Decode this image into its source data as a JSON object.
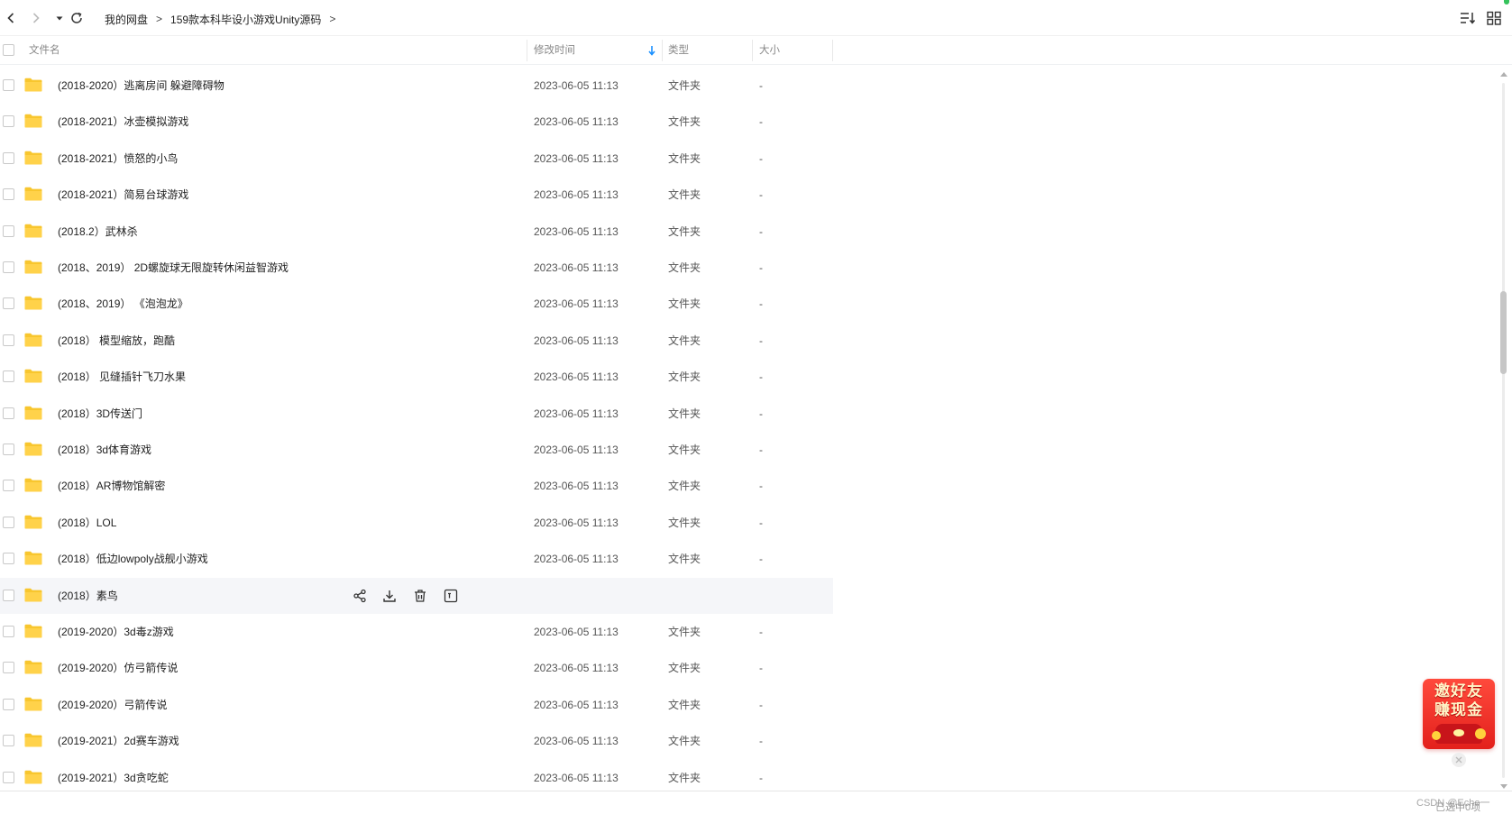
{
  "nav": {
    "breadcrumb": [
      {
        "label": "我的网盘"
      },
      {
        "label": "159款本科毕设小游戏Unity源码"
      }
    ],
    "separator": ">"
  },
  "columns": {
    "name": "文件名",
    "modified": "修改时间",
    "type": "类型",
    "size": "大小"
  },
  "files": [
    {
      "name": "(2018-2020）逃离房间 躲避障碍物",
      "modified": "2023-06-05 11:13",
      "type": "文件夹",
      "size": "-"
    },
    {
      "name": "(2018-2021）冰壶模拟游戏",
      "modified": "2023-06-05 11:13",
      "type": "文件夹",
      "size": "-"
    },
    {
      "name": "(2018-2021）愤怒的小鸟",
      "modified": "2023-06-05 11:13",
      "type": "文件夹",
      "size": "-"
    },
    {
      "name": "(2018-2021）简易台球游戏",
      "modified": "2023-06-05 11:13",
      "type": "文件夹",
      "size": "-"
    },
    {
      "name": "(2018.2）武林杀",
      "modified": "2023-06-05 11:13",
      "type": "文件夹",
      "size": "-"
    },
    {
      "name": "(2018、2019） 2D螺旋球无限旋转休闲益智游戏",
      "modified": "2023-06-05 11:13",
      "type": "文件夹",
      "size": "-"
    },
    {
      "name": "(2018、2019） 《泡泡龙》",
      "modified": "2023-06-05 11:13",
      "type": "文件夹",
      "size": "-"
    },
    {
      "name": "(2018） 模型缩放，跑酷",
      "modified": "2023-06-05 11:13",
      "type": "文件夹",
      "size": "-"
    },
    {
      "name": "(2018） 见缝插针飞刀水果",
      "modified": "2023-06-05 11:13",
      "type": "文件夹",
      "size": "-"
    },
    {
      "name": "(2018）3D传送门",
      "modified": "2023-06-05 11:13",
      "type": "文件夹",
      "size": "-"
    },
    {
      "name": "(2018）3d体育游戏",
      "modified": "2023-06-05 11:13",
      "type": "文件夹",
      "size": "-"
    },
    {
      "name": "(2018）AR博物馆解密",
      "modified": "2023-06-05 11:13",
      "type": "文件夹",
      "size": "-"
    },
    {
      "name": "(2018）LOL",
      "modified": "2023-06-05 11:13",
      "type": "文件夹",
      "size": "-"
    },
    {
      "name": "(2018）低边lowpoly战舰小游戏",
      "modified": "2023-06-05 11:13",
      "type": "文件夹",
      "size": "-"
    },
    {
      "name": "(2018）素鸟",
      "modified": "",
      "type": "",
      "size": ""
    },
    {
      "name": "(2019-2020）3d毒z游戏",
      "modified": "2023-06-05 11:13",
      "type": "文件夹",
      "size": "-"
    },
    {
      "name": "(2019-2020）仿弓箭传说",
      "modified": "2023-06-05 11:13",
      "type": "文件夹",
      "size": "-"
    },
    {
      "name": "(2019-2020）弓箭传说",
      "modified": "2023-06-05 11:13",
      "type": "文件夹",
      "size": "-"
    },
    {
      "name": "(2019-2021）2d赛车游戏",
      "modified": "2023-06-05 11:13",
      "type": "文件夹",
      "size": "-"
    },
    {
      "name": "(2019-2021）3d贪吃蛇",
      "modified": "2023-06-05 11:13",
      "type": "文件夹",
      "size": "-"
    }
  ],
  "hovered_index": 14,
  "row_actions": [
    "share-icon",
    "download-icon",
    "delete-icon",
    "more-icon"
  ],
  "scrollbar": {
    "position": 0.34,
    "visible_fraction": 0.12
  },
  "promo": {
    "line1": "邀好友",
    "line2": "赚现金"
  },
  "status_text": "已选中0项",
  "watermark": "CSDN @Echo一",
  "colors": {
    "folder": "#f8c62e",
    "sort_accent": "#1a90ff",
    "promo": "#e3201c"
  }
}
